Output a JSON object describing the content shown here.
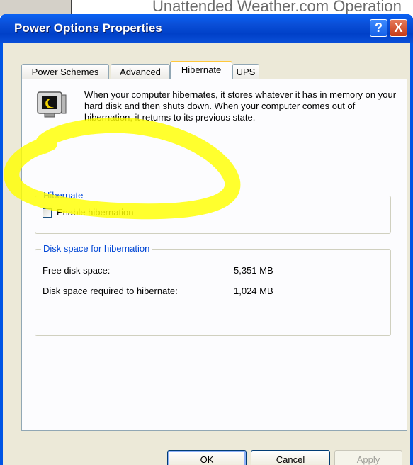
{
  "background_window": {
    "title_fragment": "Unattended Weather.com Operation"
  },
  "dialog": {
    "title": "Power Options Properties",
    "help_label": "?",
    "close_label": "X"
  },
  "tabs": [
    {
      "label": "Power Schemes",
      "active": false
    },
    {
      "label": "Advanced",
      "active": false
    },
    {
      "label": "Hibernate",
      "active": true
    },
    {
      "label": "UPS",
      "active": false
    }
  ],
  "hibernate": {
    "description": "When your computer hibernates, it stores whatever it has in memory on your hard disk and then shuts down. When your computer comes out of hibernation, it returns to its previous state.",
    "group_label": "Hibernate",
    "enable_label": "Enable hibernation",
    "enable_checked": false
  },
  "disk_space": {
    "group_label": "Disk space for hibernation",
    "free_label": "Free disk space:",
    "free_value": "5,351 MB",
    "required_label": "Disk space required to hibernate:",
    "required_value": "1,024 MB"
  },
  "buttons": {
    "ok": "OK",
    "cancel": "Cancel",
    "apply": "Apply"
  },
  "colors": {
    "titlebar": "#0a4fd8",
    "group_label": "#0046d5",
    "highlight": "#ffff00"
  }
}
